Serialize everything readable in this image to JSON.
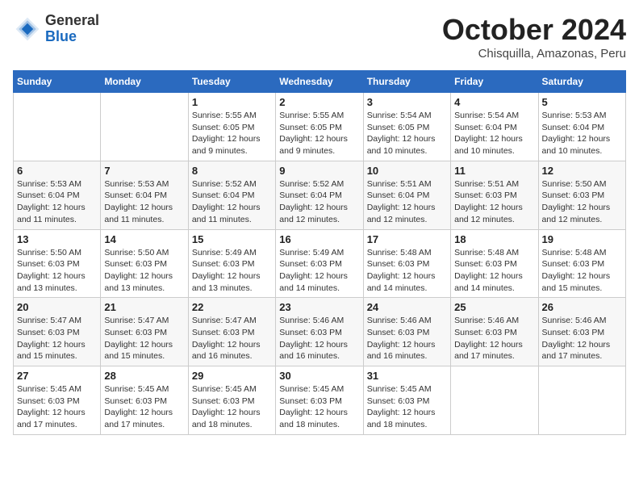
{
  "logo": {
    "general": "General",
    "blue": "Blue"
  },
  "header": {
    "month": "October 2024",
    "location": "Chisquilla, Amazonas, Peru"
  },
  "weekdays": [
    "Sunday",
    "Monday",
    "Tuesday",
    "Wednesday",
    "Thursday",
    "Friday",
    "Saturday"
  ],
  "weeks": [
    [
      {
        "day": "",
        "info": ""
      },
      {
        "day": "",
        "info": ""
      },
      {
        "day": "1",
        "info": "Sunrise: 5:55 AM\nSunset: 6:05 PM\nDaylight: 12 hours and 9 minutes."
      },
      {
        "day": "2",
        "info": "Sunrise: 5:55 AM\nSunset: 6:05 PM\nDaylight: 12 hours and 9 minutes."
      },
      {
        "day": "3",
        "info": "Sunrise: 5:54 AM\nSunset: 6:05 PM\nDaylight: 12 hours and 10 minutes."
      },
      {
        "day": "4",
        "info": "Sunrise: 5:54 AM\nSunset: 6:04 PM\nDaylight: 12 hours and 10 minutes."
      },
      {
        "day": "5",
        "info": "Sunrise: 5:53 AM\nSunset: 6:04 PM\nDaylight: 12 hours and 10 minutes."
      }
    ],
    [
      {
        "day": "6",
        "info": "Sunrise: 5:53 AM\nSunset: 6:04 PM\nDaylight: 12 hours and 11 minutes."
      },
      {
        "day": "7",
        "info": "Sunrise: 5:53 AM\nSunset: 6:04 PM\nDaylight: 12 hours and 11 minutes."
      },
      {
        "day": "8",
        "info": "Sunrise: 5:52 AM\nSunset: 6:04 PM\nDaylight: 12 hours and 11 minutes."
      },
      {
        "day": "9",
        "info": "Sunrise: 5:52 AM\nSunset: 6:04 PM\nDaylight: 12 hours and 12 minutes."
      },
      {
        "day": "10",
        "info": "Sunrise: 5:51 AM\nSunset: 6:04 PM\nDaylight: 12 hours and 12 minutes."
      },
      {
        "day": "11",
        "info": "Sunrise: 5:51 AM\nSunset: 6:03 PM\nDaylight: 12 hours and 12 minutes."
      },
      {
        "day": "12",
        "info": "Sunrise: 5:50 AM\nSunset: 6:03 PM\nDaylight: 12 hours and 12 minutes."
      }
    ],
    [
      {
        "day": "13",
        "info": "Sunrise: 5:50 AM\nSunset: 6:03 PM\nDaylight: 12 hours and 13 minutes."
      },
      {
        "day": "14",
        "info": "Sunrise: 5:50 AM\nSunset: 6:03 PM\nDaylight: 12 hours and 13 minutes."
      },
      {
        "day": "15",
        "info": "Sunrise: 5:49 AM\nSunset: 6:03 PM\nDaylight: 12 hours and 13 minutes."
      },
      {
        "day": "16",
        "info": "Sunrise: 5:49 AM\nSunset: 6:03 PM\nDaylight: 12 hours and 14 minutes."
      },
      {
        "day": "17",
        "info": "Sunrise: 5:48 AM\nSunset: 6:03 PM\nDaylight: 12 hours and 14 minutes."
      },
      {
        "day": "18",
        "info": "Sunrise: 5:48 AM\nSunset: 6:03 PM\nDaylight: 12 hours and 14 minutes."
      },
      {
        "day": "19",
        "info": "Sunrise: 5:48 AM\nSunset: 6:03 PM\nDaylight: 12 hours and 15 minutes."
      }
    ],
    [
      {
        "day": "20",
        "info": "Sunrise: 5:47 AM\nSunset: 6:03 PM\nDaylight: 12 hours and 15 minutes."
      },
      {
        "day": "21",
        "info": "Sunrise: 5:47 AM\nSunset: 6:03 PM\nDaylight: 12 hours and 15 minutes."
      },
      {
        "day": "22",
        "info": "Sunrise: 5:47 AM\nSunset: 6:03 PM\nDaylight: 12 hours and 16 minutes."
      },
      {
        "day": "23",
        "info": "Sunrise: 5:46 AM\nSunset: 6:03 PM\nDaylight: 12 hours and 16 minutes."
      },
      {
        "day": "24",
        "info": "Sunrise: 5:46 AM\nSunset: 6:03 PM\nDaylight: 12 hours and 16 minutes."
      },
      {
        "day": "25",
        "info": "Sunrise: 5:46 AM\nSunset: 6:03 PM\nDaylight: 12 hours and 17 minutes."
      },
      {
        "day": "26",
        "info": "Sunrise: 5:46 AM\nSunset: 6:03 PM\nDaylight: 12 hours and 17 minutes."
      }
    ],
    [
      {
        "day": "27",
        "info": "Sunrise: 5:45 AM\nSunset: 6:03 PM\nDaylight: 12 hours and 17 minutes."
      },
      {
        "day": "28",
        "info": "Sunrise: 5:45 AM\nSunset: 6:03 PM\nDaylight: 12 hours and 17 minutes."
      },
      {
        "day": "29",
        "info": "Sunrise: 5:45 AM\nSunset: 6:03 PM\nDaylight: 12 hours and 18 minutes."
      },
      {
        "day": "30",
        "info": "Sunrise: 5:45 AM\nSunset: 6:03 PM\nDaylight: 12 hours and 18 minutes."
      },
      {
        "day": "31",
        "info": "Sunrise: 5:45 AM\nSunset: 6:03 PM\nDaylight: 12 hours and 18 minutes."
      },
      {
        "day": "",
        "info": ""
      },
      {
        "day": "",
        "info": ""
      }
    ]
  ]
}
